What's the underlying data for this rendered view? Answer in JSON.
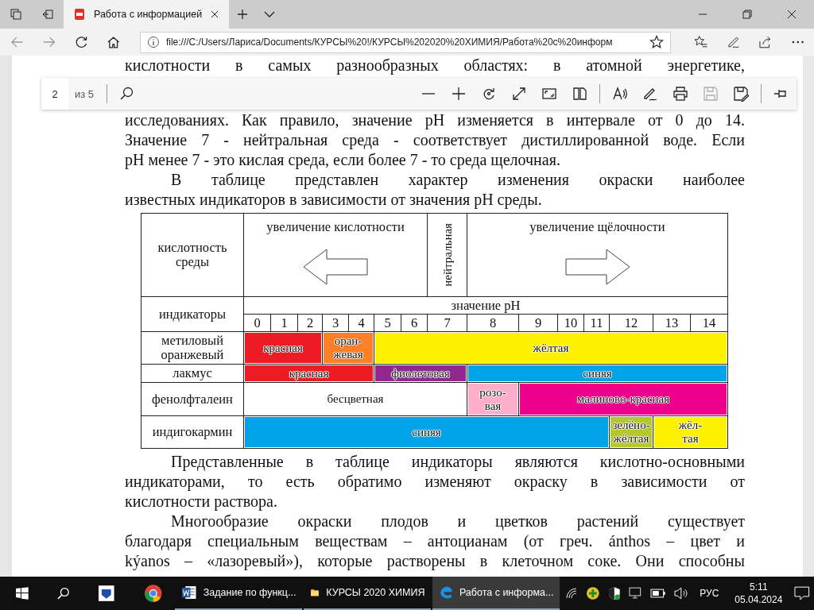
{
  "browser": {
    "tab": {
      "title": "Работа с информацией",
      "selected": true
    },
    "address": {
      "url": "file:///C:/Users/Лариса/Documents/КУРСЫ%20!/КУРСЫ%202020%20ХИМИЯ/Работа%20с%20информ"
    },
    "pdf_toolbar": {
      "page": "2",
      "page_count": "из 5",
      "tools": [
        {
          "kind": "zoom-out",
          "disabled": false
        },
        {
          "kind": "zoom-in",
          "disabled": false
        },
        {
          "kind": "rotate",
          "disabled": false
        },
        {
          "kind": "fit",
          "disabled": false
        },
        {
          "kind": "fullscreen",
          "disabled": false
        },
        {
          "kind": "page-view",
          "disabled": false
        },
        {
          "sep": true,
          "kind": "read-aloud",
          "disabled": false
        },
        {
          "kind": "draw",
          "disabled": false
        },
        {
          "kind": "print",
          "disabled": false
        },
        {
          "kind": "save",
          "disabled": true
        },
        {
          "kind": "save-as",
          "disabled": false
        },
        {
          "sep": true,
          "kind": "pin",
          "disabled": false
        }
      ]
    }
  },
  "document": {
    "paragraphs_before": [
      {
        "indented": false,
        "continues": false,
        "lines": [
          "кислотности в самых разнообразных областях: в атомной энергетике,",
          "исследованиях. Как правило, значение pH изменяется в интервале от 0 до 14.",
          "Значение 7 - нейтральная среда - соответствует дистиллированной воде. Если",
          "pH менее 7 - это кислая среда, если более 7 - то среда щелочная."
        ]
      },
      {
        "indented": true,
        "continues": false,
        "lines": [
          "В таблице представлен характер изменения окраски наиболее",
          "известных индикаторов в зависимости от значения pH среды."
        ]
      }
    ],
    "table": {
      "acidity_label": "кислотность среды",
      "acid_label": "увеличение кислотности",
      "neutral_label": "нейтральная",
      "base_label": "увеличение щёлочности",
      "indicators_label": "индикаторы",
      "ph_label": "значение pH",
      "ph": [
        "0",
        "1",
        "2",
        "3",
        "4",
        "5",
        "6",
        "7",
        "8",
        "9",
        "10",
        "11",
        "12",
        "13",
        "14"
      ],
      "rows": [
        {
          "name": "метиловый оранжевый",
          "bands": [
            {
              "label": "красная",
              "color": "#ed1c24"
            },
            {
              "label": "оран-\nжевая",
              "color": "#ff7f27"
            },
            {
              "label": "жёлтая",
              "color": "#fff200"
            }
          ]
        },
        {
          "name": "лакмус",
          "bands": [
            {
              "label": "красная",
              "color": "#ed1c24"
            },
            {
              "label": "фиолетовая",
              "color": "#92278f"
            },
            {
              "label": "синяя",
              "color": "#00a2e8"
            }
          ]
        },
        {
          "name": "фенолфталеин",
          "bands": [
            {
              "label": "бесцветная",
              "color": "#ffffff"
            },
            {
              "label": "розо-\nвая",
              "color": "#ffaec9"
            },
            {
              "label": "малиново-красная",
              "color": "#ec008c"
            }
          ]
        },
        {
          "name": "индигокармин",
          "bands": [
            {
              "label": "синяя",
              "color": "#00a2e8"
            },
            {
              "label": "зелёно-\nжёлтая",
              "color": "#b5c72b"
            },
            {
              "label": "жёл-\nтая",
              "color": "#fff200"
            }
          ]
        }
      ]
    },
    "paragraphs_after": [
      {
        "indented": true,
        "continues": false,
        "lines": [
          "Представленные в таблице индикаторы являются кислотно-основными",
          "индикаторами, то есть обратимо изменяют окраску в зависимости от",
          "кислотности раствора."
        ]
      },
      {
        "indented": true,
        "continues": true,
        "lines": [
          "Многообразие окраски плодов и цветков растений существует",
          "благодаря специальным веществам – антоцианам (от греч. ánthos – цвет и",
          "kýanos – «лазоревый»), которые растворены в клеточном соке. Они способны"
        ]
      }
    ]
  },
  "taskbar": {
    "apps": [
      {
        "kind": "word",
        "label": "Задание по функц...",
        "active": false
      },
      {
        "kind": "folder",
        "label": "КУРСЫ 2020 ХИМИЯ",
        "active": false
      },
      {
        "kind": "edge",
        "label": "Работа с информа...",
        "active": true
      }
    ],
    "language": "РУС",
    "time": "5:11",
    "date": "05.04.2024"
  }
}
